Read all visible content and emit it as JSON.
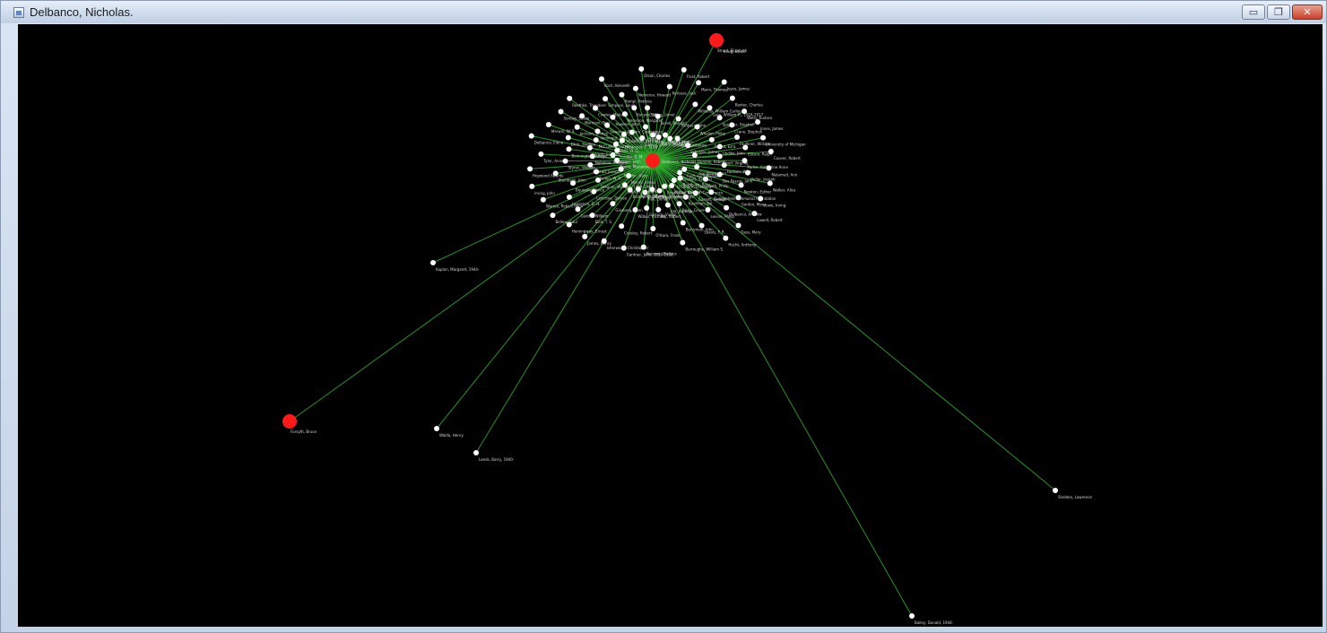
{
  "window": {
    "title": "Delbanco, Nicholas.",
    "controls": {
      "minimize": "▭",
      "maximize": "❐",
      "close": "✕"
    }
  },
  "graph": {
    "colors": {
      "edge": "#2fae2f",
      "node": "#ffffff",
      "highlight": "#ff1a1a",
      "background": "#000000"
    },
    "nodes": [
      {
        "id": "n1",
        "label": "Strout, Elizabeth",
        "highlight": true
      },
      {
        "id": "n2",
        "label": "Stegner, Wallace, 1909-1993"
      },
      {
        "id": "n3",
        "label": "Gass, William H., 1924-2017"
      },
      {
        "id": "n4",
        "label": "Gardner, John, 1933-1982"
      },
      {
        "id": "n5",
        "label": "Cheever, John"
      },
      {
        "id": "n6",
        "label": "Updike, John"
      },
      {
        "id": "n7",
        "label": "Gaddis, William"
      },
      {
        "id": "n8",
        "label": "Mann, Thomas"
      },
      {
        "id": "n9",
        "label": "Ford, Ford Madox"
      },
      {
        "id": "n10",
        "label": "Conrad, Joseph"
      },
      {
        "id": "n11",
        "label": "Crane, Stephen"
      },
      {
        "id": "n12",
        "label": "James, Henry"
      },
      {
        "id": "n13",
        "label": "Wells, H. G."
      },
      {
        "id": "n14",
        "label": "Hudson, W. H."
      },
      {
        "id": "n15",
        "label": "Bourjaily, Vance"
      },
      {
        "id": "n16",
        "label": "Baxter, Charles"
      },
      {
        "id": "n17",
        "label": "Bradbury, Ray"
      },
      {
        "id": "n18",
        "label": "Hirsch, Edward"
      },
      {
        "id": "n19",
        "label": "Ellison, Ralph"
      },
      {
        "id": "n20",
        "label": "Bellow, Saul"
      },
      {
        "id": "n21",
        "label": "Malamud, Bernard"
      },
      {
        "id": "n22",
        "label": "Roth, Philip"
      },
      {
        "id": "n23",
        "label": "Styron, William"
      },
      {
        "id": "n24",
        "label": "Jones, James"
      },
      {
        "id": "n25",
        "label": "Mailer, Norman"
      },
      {
        "id": "n26",
        "label": "Vonnegut, Kurt"
      },
      {
        "id": "n27",
        "label": "Heller, Joseph"
      },
      {
        "id": "n28",
        "label": "Irving, John"
      },
      {
        "id": "n29",
        "label": "Fowles, John"
      },
      {
        "id": "n30",
        "label": "Garrett, George"
      },
      {
        "id": "n31",
        "label": "Elkin, Stanley"
      },
      {
        "id": "n32",
        "label": "Coover, Robert"
      },
      {
        "id": "n33",
        "label": "Barth, John"
      },
      {
        "id": "n34",
        "label": "Hawkes, John"
      },
      {
        "id": "n35",
        "label": "Gordon, Mary"
      },
      {
        "id": "n36",
        "label": "Tyler, Anne"
      },
      {
        "id": "n37",
        "label": "Oates, Joyce Carol"
      },
      {
        "id": "n38",
        "label": "Paley, Grace"
      },
      {
        "id": "n39",
        "label": "Morrison, Toni"
      },
      {
        "id": "n40",
        "label": "Walker, Alice"
      },
      {
        "id": "n41",
        "label": "Hall, Donald"
      },
      {
        "id": "n42",
        "label": "Kenyon, Jane"
      },
      {
        "id": "n43",
        "label": "Levine, Philip"
      },
      {
        "id": "n44",
        "label": "Merwin, W. S."
      },
      {
        "id": "n45",
        "label": "Wright, James"
      },
      {
        "id": "n46",
        "label": "Bly, Robert"
      },
      {
        "id": "n47",
        "label": "Simpson, Louis"
      },
      {
        "id": "n48",
        "label": "Lowell, Robert"
      },
      {
        "id": "n49",
        "label": "Bishop, Elizabeth"
      },
      {
        "id": "n50",
        "label": "Jarrell, Randall"
      },
      {
        "id": "n51",
        "label": "Berryman, John"
      },
      {
        "id": "n52",
        "label": "Roethke, Theodore"
      },
      {
        "id": "n53",
        "label": "Kunitz, Stanley"
      },
      {
        "id": "n54",
        "label": "Wilbur, Richard"
      },
      {
        "id": "n55",
        "label": "Nemerov, Howard"
      },
      {
        "id": "n56",
        "label": "Hecht, Anthony"
      },
      {
        "id": "n57",
        "label": "Merrill, James"
      },
      {
        "id": "n58",
        "label": "Ashbery, John"
      },
      {
        "id": "n59",
        "label": "O'Hara, Frank"
      },
      {
        "id": "n60",
        "label": "Koch, Kenneth"
      },
      {
        "id": "n61",
        "label": "Schuyler, James"
      },
      {
        "id": "n62",
        "label": "Ginsberg, Allen"
      },
      {
        "id": "n63",
        "label": "Kerouac, Jack"
      },
      {
        "id": "n64",
        "label": "Burroughs, William S."
      },
      {
        "id": "n65",
        "label": "Snyder, Gary"
      },
      {
        "id": "n66",
        "label": "Whalen, Philip"
      },
      {
        "id": "n67",
        "label": "Creeley, Robert"
      },
      {
        "id": "n68",
        "label": "Olson, Charles"
      },
      {
        "id": "n69",
        "label": "Duncan, Robert"
      },
      {
        "id": "n70",
        "label": "Levertov, Denise"
      },
      {
        "id": "n71",
        "label": "Williams, William Carlos"
      },
      {
        "id": "n72",
        "label": "Stevens, Wallace"
      },
      {
        "id": "n73",
        "label": "Moore, Marianne"
      },
      {
        "id": "n74",
        "label": "Pound, Ezra"
      },
      {
        "id": "n75",
        "label": "Eliot, T. S."
      },
      {
        "id": "n76",
        "label": "Frost, Robert"
      },
      {
        "id": "n77",
        "label": "Sandburg, Carl"
      },
      {
        "id": "n78",
        "label": "Auden, W. H."
      },
      {
        "id": "n79",
        "label": "Spender, Stephen"
      },
      {
        "id": "n80",
        "label": "Isherwood, Christopher"
      },
      {
        "id": "n81",
        "label": "Forster, E. M."
      },
      {
        "id": "n82",
        "label": "Woolf, Virginia"
      },
      {
        "id": "n83",
        "label": "Lawrence, D. H."
      },
      {
        "id": "n84",
        "label": "Joyce, James"
      },
      {
        "id": "n85",
        "label": "Beckett, Samuel"
      },
      {
        "id": "n86",
        "label": "Nabokov, Vladimir"
      },
      {
        "id": "n87",
        "label": "Faulkner, William"
      },
      {
        "id": "n88",
        "label": "Hemingway, Ernest"
      },
      {
        "id": "n89",
        "label": "Fitzgerald, F. Scott"
      },
      {
        "id": "n90",
        "label": "Dos Passos, John"
      },
      {
        "id": "n91",
        "label": "Steinbeck, John"
      },
      {
        "id": "n92",
        "label": "Welty, Eudora"
      },
      {
        "id": "n93",
        "label": "O'Connor, Flannery"
      },
      {
        "id": "n94",
        "label": "McCullers, Carson"
      },
      {
        "id": "n95",
        "label": "Porter, Katherine Anne"
      },
      {
        "id": "n96",
        "label": "Warren, Robert Penn"
      },
      {
        "id": "n97",
        "label": "Taylor, Peter"
      },
      {
        "id": "n98",
        "label": "Guggenheim Memorial Foundation"
      },
      {
        "id": "n99",
        "label": "Bennington College"
      },
      {
        "id": "n100",
        "label": "University of Michigan"
      },
      {
        "id": "n101",
        "label": "Bread Loaf Writers' Conference"
      },
      {
        "id": "n102",
        "label": "Sewanee Writers' Conference"
      },
      {
        "id": "n103",
        "label": "Newton, Esther"
      },
      {
        "id": "n104",
        "label": "Hopwood Awards"
      },
      {
        "id": "n105",
        "label": "Yaddo"
      },
      {
        "id": "n106",
        "label": "Kaufman, Bel"
      },
      {
        "id": "n107",
        "label": "Jackson, Shirley"
      },
      {
        "id": "n108",
        "label": "Malamud, Ann"
      },
      {
        "id": "n109",
        "label": "Hyman, Stanley Edgar"
      },
      {
        "id": "n110",
        "label": "Nemerov, Margaret"
      },
      {
        "id": "n111",
        "label": "Delbanco, Andrew"
      },
      {
        "id": "n112",
        "label": "Delbanco, Elena"
      },
      {
        "id": "n113",
        "label": "Foley, Martha"
      },
      {
        "id": "n114",
        "label": "Gill, Brendan"
      },
      {
        "id": "n115",
        "label": "Cowley, Malcolm"
      },
      {
        "id": "n116",
        "label": "Howe, Irving"
      },
      {
        "id": "n117",
        "label": "Kazin, Alfred"
      },
      {
        "id": "n118",
        "label": "Trilling, Lionel"
      },
      {
        "id": "n119",
        "label": "Leavis, F. R."
      },
      {
        "id": "n120",
        "label": "Sontag, Susan"
      },
      {
        "id": "n121",
        "label": "Didion, Joan"
      },
      {
        "id": "n122",
        "label": "Gornick, Vivian"
      },
      {
        "id": "n123",
        "label": "Hampl, Patricia"
      },
      {
        "id": "n124",
        "label": "Gass, Mary"
      },
      {
        "id": "n125",
        "label": "Bausch, Richard"
      }
    ],
    "outliers": [
      {
        "id": "o1",
        "label": "Kraig, Bruce",
        "highlight": true
      },
      {
        "id": "o2",
        "label": "Forsyth, Bruce",
        "highlight": true
      },
      {
        "id": "o3",
        "label": "Kaplan, Margaret, 1944-"
      },
      {
        "id": "o4",
        "label": "Waldo, Henry"
      },
      {
        "id": "o5",
        "label": "Leeds, Barry, 1940-"
      },
      {
        "id": "o6",
        "label": "Sheldon, Lawrence"
      },
      {
        "id": "o7",
        "label": "Bailey, Donald, 1944-"
      }
    ],
    "center": {
      "label": "Delbanco, Nicholas."
    }
  }
}
